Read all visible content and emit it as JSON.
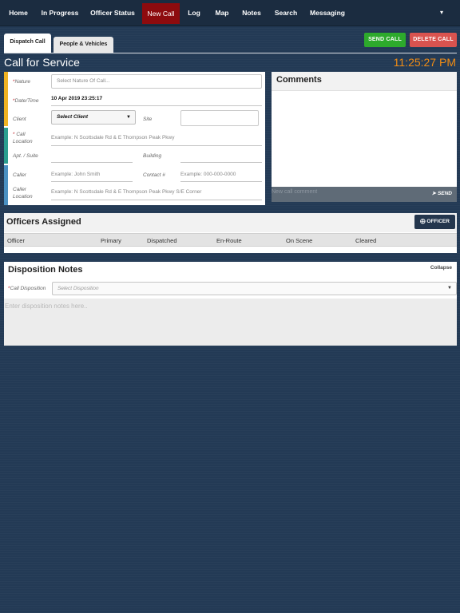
{
  "nav": {
    "items": [
      {
        "label": "Home"
      },
      {
        "label": "In Progress"
      },
      {
        "label": "Officer Status"
      },
      {
        "label": "New Call"
      },
      {
        "label": "Log"
      },
      {
        "label": "Map"
      },
      {
        "label": "Notes"
      },
      {
        "label": "Search"
      },
      {
        "label": "Messaging"
      }
    ],
    "active_index": 3,
    "active_color": "#8d0b0e",
    "more_caret": "▾"
  },
  "tabs": [
    {
      "label": "Dispatch Call",
      "active": true
    },
    {
      "label": "People & Vehicles",
      "active": false
    }
  ],
  "actions": {
    "send_call": "SEND CALL",
    "delete_call": "DELETE CALL",
    "send_color": "#2daa2c",
    "delete_color": "#d9534f"
  },
  "page_title": "Call for Service",
  "clock": "11:25:27 PM",
  "form": {
    "required_mark": "*",
    "nature": {
      "label": "Nature",
      "placeholder": "Select Nature Of Call..."
    },
    "datetime": {
      "label": "Date/Time",
      "value": "10 Apr 2019  23:25:17"
    },
    "client": {
      "label": "Client",
      "value": "Select Client"
    },
    "site": {
      "label": "Site",
      "value": ""
    },
    "call_location": {
      "label_line1": "Call",
      "label_line2": "Location",
      "placeholder": "Example: N Scottsdale Rd & E Thompson Peak Pkwy"
    },
    "apt_suite": {
      "label": "Apt. / Suite",
      "value": ""
    },
    "building": {
      "label": "Building",
      "value": ""
    },
    "caller": {
      "label": "Caller",
      "placeholder": "Example: John Smith"
    },
    "contact": {
      "label": "Contact #",
      "placeholder": "Example: 000-000-0000"
    },
    "caller_location": {
      "label_line1": "Caller",
      "label_line2": "Location",
      "placeholder": "Example: N Scottsdale Rd & E Thompson Peak Pkwy S/E Corner"
    },
    "stripe_colors": [
      "#f0b323",
      "#2a9d8f",
      "#4a90c2"
    ]
  },
  "comments": {
    "title": "Comments",
    "input_placeholder": "New call comment",
    "send_label": "SEND",
    "send_icon": "paper-plane-icon"
  },
  "officers": {
    "title": "Officers Assigned",
    "add_button": "OFFICER",
    "add_icon": "plus-circle-icon",
    "columns": [
      "Officer",
      "Primary",
      "Dispatched",
      "En-Route",
      "On Scene",
      "Cleared"
    ]
  },
  "disposition": {
    "title": "Disposition Notes",
    "collapse_label": "Collapse",
    "call_disposition_label": "Call Disposition",
    "select_placeholder": "Select Disposition",
    "notes_placeholder": "Enter disposition notes here.."
  }
}
